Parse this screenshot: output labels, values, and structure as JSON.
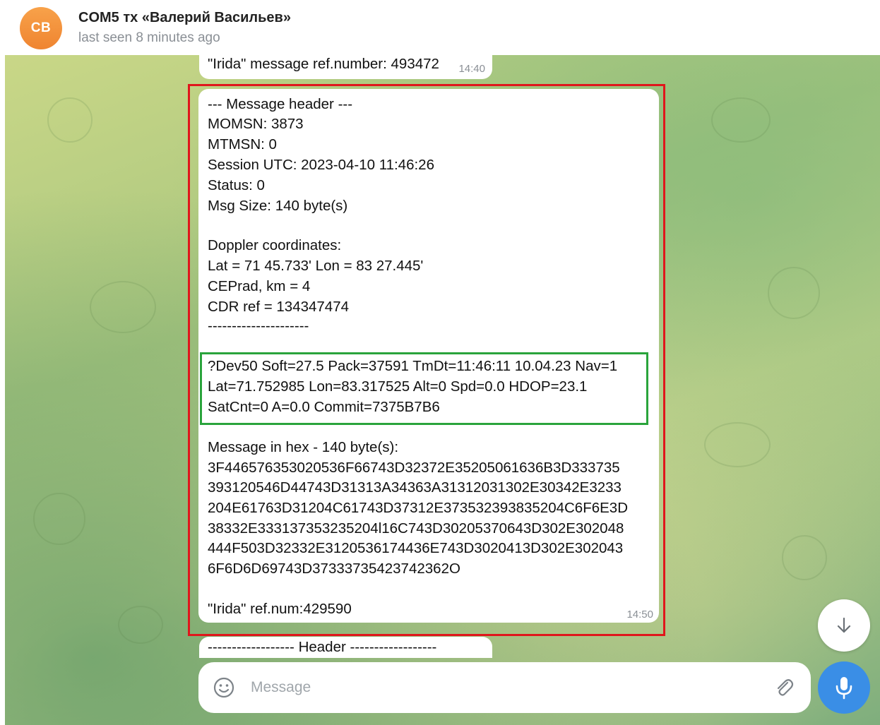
{
  "header": {
    "avatar_initials": "CB",
    "title": "COM5 тх «Валерий Васильев»",
    "status": "last seen 8 minutes ago"
  },
  "messages": {
    "top": {
      "text": "\"Irida\" message ref.number: 493472",
      "time": "14:40"
    },
    "main": {
      "lines": [
        "--- Message header ---",
        "MOMSN: 3873",
        "MTMSN: 0",
        "Session UTC: 2023-04-10 11:46:26",
        "Status: 0",
        "Msg Size: 140 byte(s)",
        "",
        "Doppler coordinates:",
        "Lat =  71  45.733' Lon =   83  27.445'",
        "CEPrad, km = 4",
        "CDR ref = 134347474",
        "---------------------",
        "",
        "?Dev50 Soft=27.5 Pack=37591 TmDt=11:46:11 10.04.23 Nav=1",
        "Lat=71.752985 Lon=83.317525 Alt=0 Spd=0.0 HDOP=23.1",
        "SatCnt=0 A=0.0 Commit=7375B7B6",
        "",
        "Message in hex - 140 byte(s):",
        "3F446576353020536F66743D32372E35205061636B3D333735",
        "393120546D44743D31313A34363A31312031302E30342E3233",
        "204E61763D31204C61743D37312E373532393835204C6F6E3D",
        "38332E333137353235204l16C743D30205370643D302E302048",
        "444F503D32332E3120536174436E743D3020413D302E302043",
        "6F6D6D69743D37333735423742362O",
        "",
        "\"Irida\" ref.num:429590"
      ],
      "time": "14:50"
    },
    "bottom": {
      "text": "------------------ Header ------------------"
    }
  },
  "input": {
    "placeholder": "Message"
  },
  "colors": {
    "highlight_red": "#e0161c",
    "highlight_green": "#2aa43c",
    "mic_button": "#3a8ee6",
    "avatar": "#f39a3d"
  }
}
